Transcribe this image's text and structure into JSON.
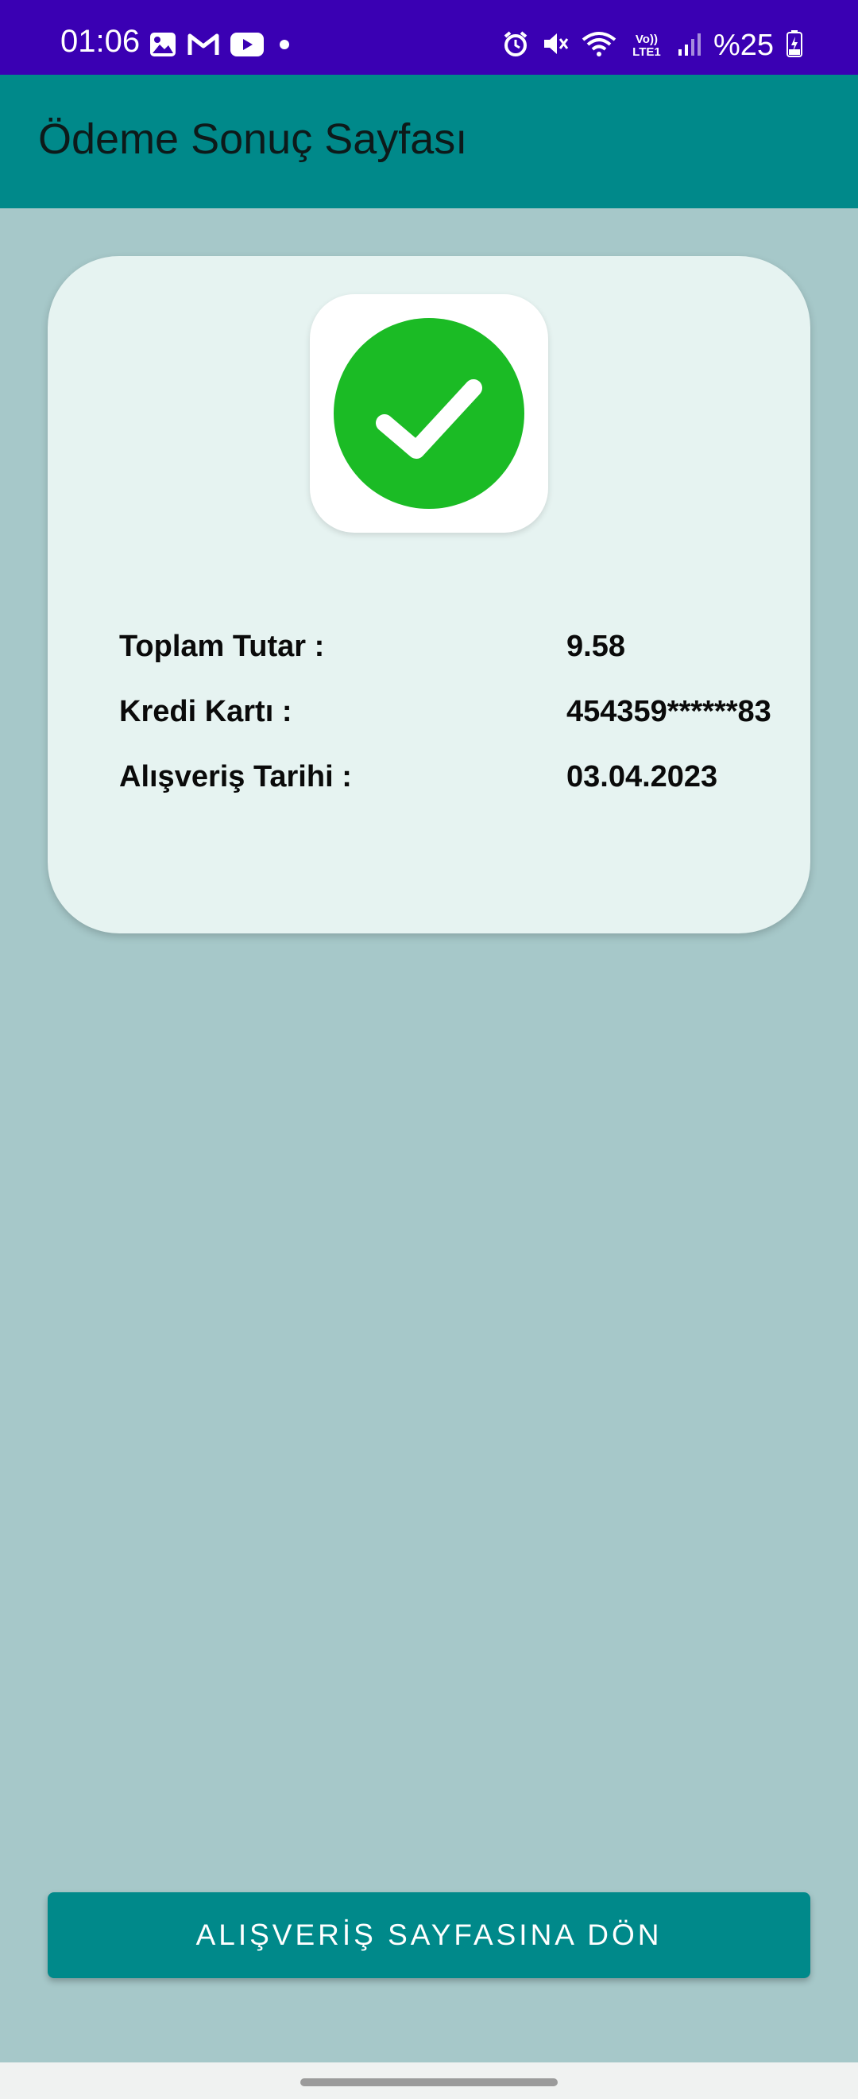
{
  "status_bar": {
    "time": "01:06",
    "left_icons": [
      "gallery-icon",
      "gmail-icon",
      "youtube-icon",
      "dot-icon"
    ],
    "right_icons": [
      "alarm-icon",
      "mute-icon",
      "wifi-icon",
      "volte-icon",
      "signal-icon"
    ],
    "volte_label": "Vo)) LTE1",
    "battery_text": "%25",
    "background_color": "#3a00b3"
  },
  "app_bar": {
    "title": "Ödeme Sonuç Sayfası",
    "background_color": "#00898a"
  },
  "result_card": {
    "status_icon": "check-circle-icon",
    "status_color": "#1bbb25",
    "rows": [
      {
        "label": "Toplam Tutar :",
        "value": "9.58"
      },
      {
        "label": "Kredi Kartı :",
        "value": "454359******83"
      },
      {
        "label": "Alışveriş Tarihi :",
        "value": "03.04.2023"
      }
    ]
  },
  "actions": {
    "back_button_label": "ALIŞVERİŞ SAYFASINA DÖN"
  },
  "colors": {
    "page_background": "#a6c8c9",
    "card_background": "#e6f3f1",
    "accent": "#00898a"
  }
}
